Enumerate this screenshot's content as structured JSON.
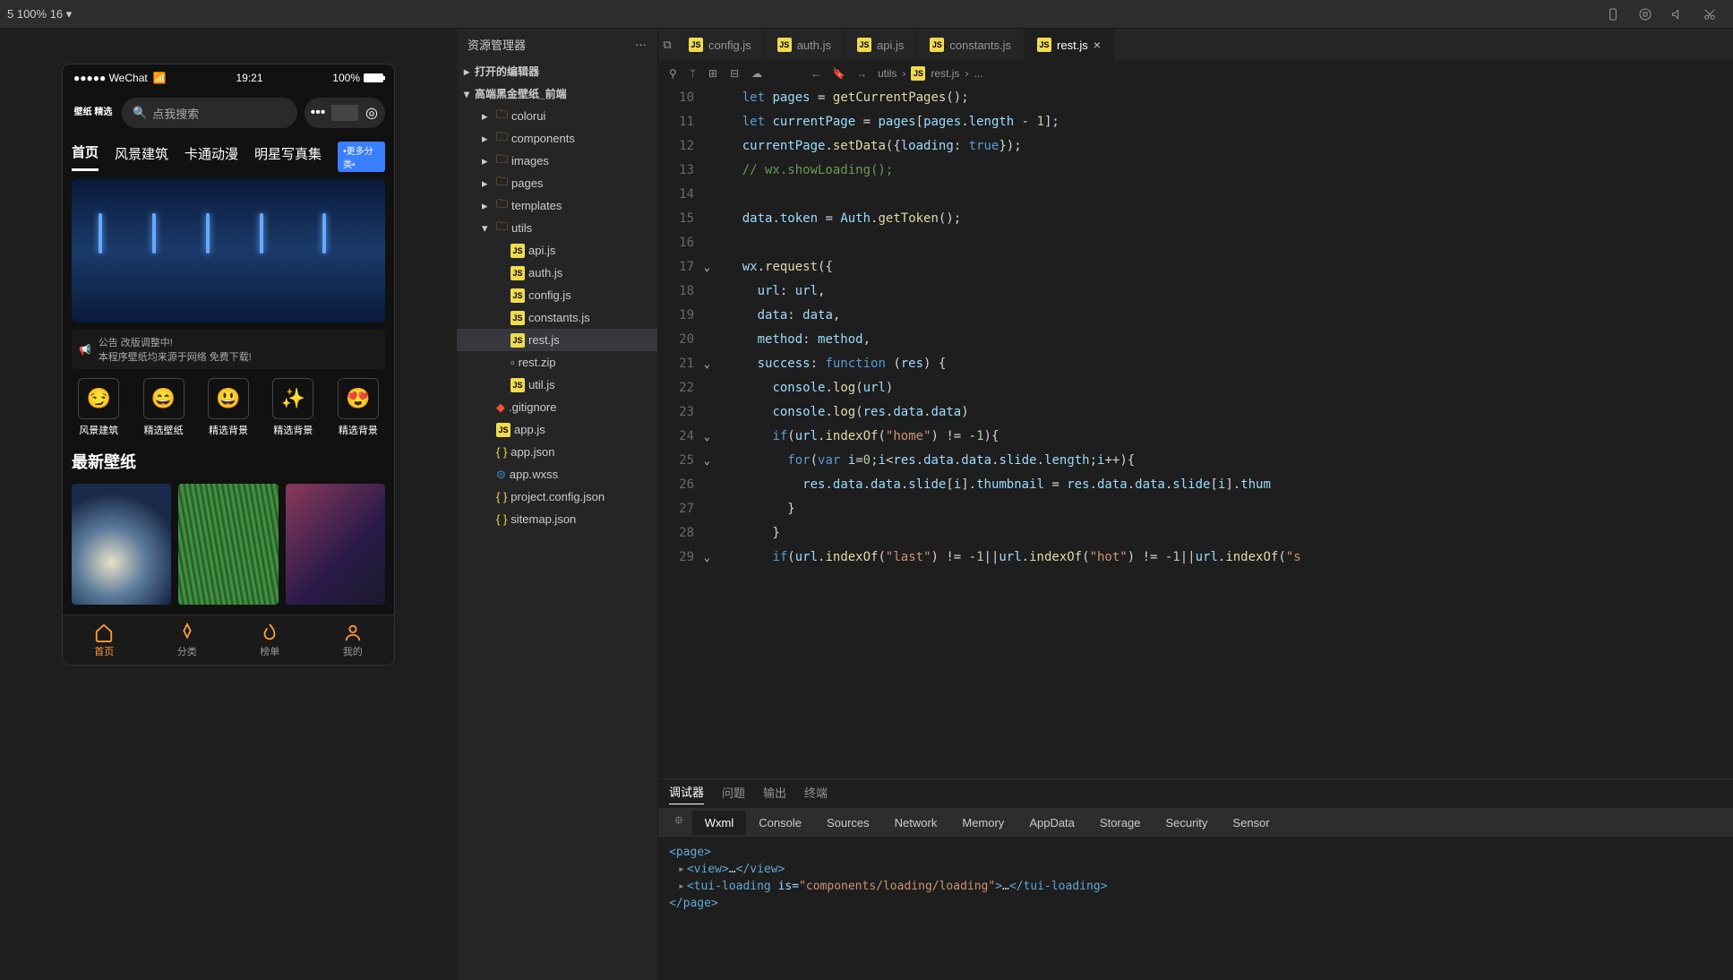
{
  "toolbar": {
    "zoom": "5 100% 16 ▾"
  },
  "simulator": {
    "status": {
      "carrier": "●●●●● WeChat",
      "time": "19:21",
      "battery_pct": "100%"
    },
    "app_logo": "壁纸\n精选",
    "search_placeholder": "点我搜索",
    "tabs": [
      "首页",
      "风景建筑",
      "卡通动漫",
      "明星写真集"
    ],
    "more_label": "•更多分类•",
    "notice": "公告  改版调整中!",
    "notice2": "本程序壁纸均来源于网络 免费下载!",
    "categories": [
      {
        "icon": "😏",
        "label": "风景建筑"
      },
      {
        "icon": "😄",
        "label": "精选壁纸"
      },
      {
        "icon": "😃",
        "label": "精选背景"
      },
      {
        "icon": "✨",
        "label": "精选背景"
      },
      {
        "icon": "😍",
        "label": "精选背景"
      }
    ],
    "section_title": "最新壁纸",
    "bottom_nav": [
      {
        "label": "首页",
        "active": true
      },
      {
        "label": "分类",
        "active": false
      },
      {
        "label": "榜单",
        "active": false
      },
      {
        "label": "我的",
        "active": false
      }
    ]
  },
  "explorer": {
    "title": "资源管理器",
    "sections": {
      "open_editors": "打开的编辑器",
      "project": "高端黑金壁纸_前端"
    },
    "tree": [
      {
        "name": "colorui",
        "type": "folder",
        "indent": 1
      },
      {
        "name": "components",
        "type": "folder",
        "indent": 1
      },
      {
        "name": "images",
        "type": "folder",
        "indent": 1
      },
      {
        "name": "pages",
        "type": "folder",
        "indent": 1
      },
      {
        "name": "templates",
        "type": "folder",
        "indent": 1
      },
      {
        "name": "utils",
        "type": "folder",
        "indent": 1,
        "open": true
      },
      {
        "name": "api.js",
        "type": "js",
        "indent": 2
      },
      {
        "name": "auth.js",
        "type": "js",
        "indent": 2
      },
      {
        "name": "config.js",
        "type": "js",
        "indent": 2
      },
      {
        "name": "constants.js",
        "type": "js",
        "indent": 2
      },
      {
        "name": "rest.js",
        "type": "js",
        "indent": 2,
        "active": true
      },
      {
        "name": "rest.zip",
        "type": "zip",
        "indent": 2
      },
      {
        "name": "util.js",
        "type": "js",
        "indent": 2
      },
      {
        "name": ".gitignore",
        "type": "git",
        "indent": 1
      },
      {
        "name": "app.js",
        "type": "js",
        "indent": 1
      },
      {
        "name": "app.json",
        "type": "json",
        "indent": 1
      },
      {
        "name": "app.wxss",
        "type": "wxss",
        "indent": 1
      },
      {
        "name": "project.config.json",
        "type": "json",
        "indent": 1
      },
      {
        "name": "sitemap.json",
        "type": "json",
        "indent": 1
      }
    ]
  },
  "editor": {
    "tabs": [
      {
        "label": "config.js"
      },
      {
        "label": "auth.js"
      },
      {
        "label": "api.js"
      },
      {
        "label": "constants.js"
      },
      {
        "label": "rest.js",
        "active": true
      }
    ],
    "breadcrumb": [
      "utils",
      "rest.js",
      "..."
    ],
    "line_numbers": [
      "",
      "11",
      "12",
      "13",
      "14",
      "",
      "16",
      "17",
      "18",
      "19",
      "20",
      "21",
      "22",
      "23",
      "24",
      "25",
      "26",
      "27",
      "28",
      "29"
    ],
    "lines_start": 10
  },
  "panel": {
    "tabs1": [
      "调试器",
      "问题",
      "输出",
      "终端"
    ],
    "tabs2": [
      "Wxml",
      "Console",
      "Sources",
      "Network",
      "Memory",
      "AppData",
      "Storage",
      "Security",
      "Sensor"
    ],
    "wxml": {
      "l1a": "<page>",
      "l2a": "<view>",
      "l2b": "…",
      "l2c": "</view>",
      "l3a": "<tui-loading",
      "l3attr": " is=",
      "l3val": "\"components/loading/loading\"",
      "l3b": ">",
      "l3c": "…",
      "l3d": "</tui-loading>",
      "l4a": "</page>"
    }
  }
}
